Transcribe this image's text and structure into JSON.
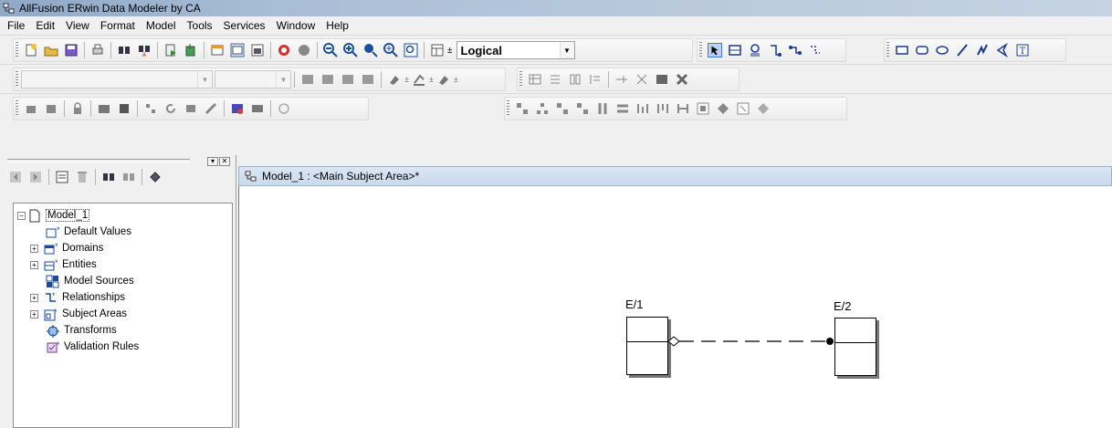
{
  "window": {
    "title": "AllFusion ERwin Data Modeler by CA"
  },
  "menu": [
    "File",
    "Edit",
    "View",
    "Format",
    "Model",
    "Tools",
    "Services",
    "Window",
    "Help"
  ],
  "toolbar": {
    "model_view_selected": "Logical"
  },
  "left_pane": {
    "tree": {
      "root": "Model_1",
      "items": [
        {
          "label": "Default Values",
          "icon": "default-values-icon",
          "expandable": false
        },
        {
          "label": "Domains",
          "icon": "domains-icon",
          "expandable": true
        },
        {
          "label": "Entities",
          "icon": "entities-icon",
          "expandable": true
        },
        {
          "label": "Model Sources",
          "icon": "model-sources-icon",
          "expandable": false
        },
        {
          "label": "Relationships",
          "icon": "relationships-icon",
          "expandable": true
        },
        {
          "label": "Subject Areas",
          "icon": "subject-areas-icon",
          "expandable": true
        },
        {
          "label": "Transforms",
          "icon": "transforms-icon",
          "expandable": false
        },
        {
          "label": "Validation Rules",
          "icon": "validation-rules-icon",
          "expandable": false
        }
      ]
    }
  },
  "diagram_window": {
    "title": "Model_1 : <Main Subject Area>*",
    "entities": [
      {
        "name": "E/1"
      },
      {
        "name": "E/2"
      }
    ],
    "relationship": {
      "style": "dashed",
      "cardinality_start": "zero-or-one-diamond",
      "cardinality_end": "many-dot"
    }
  },
  "colors": {
    "titlebar_start": "#8fa8c6",
    "doc_title_bg": "#c9d9ec",
    "canvas_bg": "#ffffff"
  }
}
